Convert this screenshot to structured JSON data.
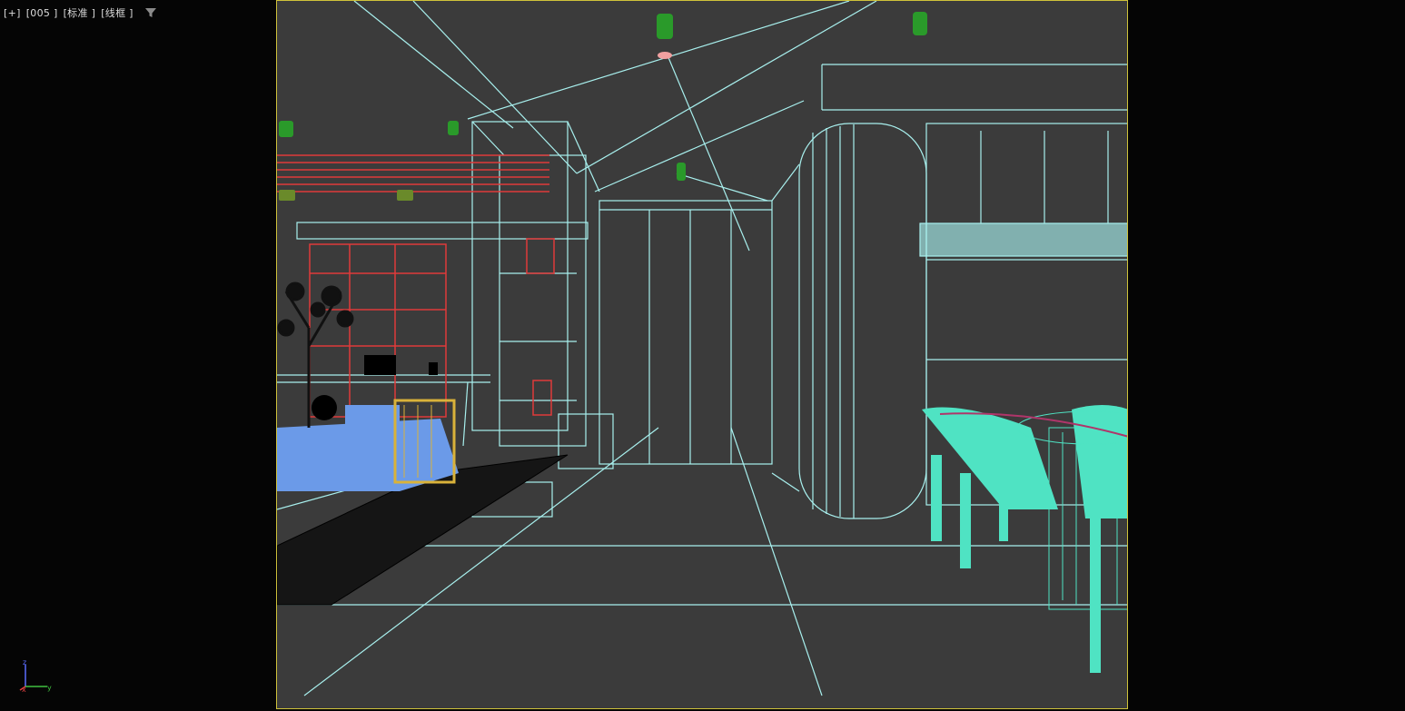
{
  "viewport": {
    "labels": {
      "plus": "[+]",
      "camera": "[005 ]",
      "shading_style": "[标准 ]",
      "display_mode": "[线框 ]"
    },
    "filter_icon": "filter-icon",
    "frame_color": "#cfc23a",
    "background_color": "#3b3b3b",
    "outer_background": "#050505"
  },
  "scene": {
    "wire_color": "#a8f0ee",
    "chair_color": "#4fe3c3",
    "sofa_color": "#6b9ae8",
    "sofa_frame_color": "#d9b23a",
    "shelf_color": "#e03a3a",
    "light_color": "#2a9a2a",
    "tree_color": "#111111"
  },
  "axis_gizmo": {
    "z": "z",
    "x": "x",
    "y": "y",
    "z_color": "#5b6cff",
    "x_color": "#e04040",
    "y_color": "#40c040"
  }
}
